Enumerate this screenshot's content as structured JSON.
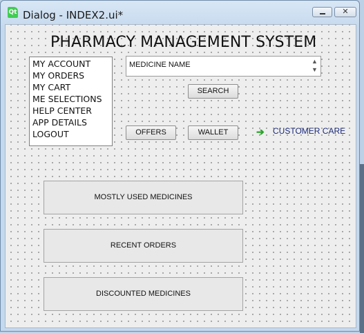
{
  "window": {
    "title": "Dialog - INDEX2.ui*",
    "app_icon_text": "Qt",
    "minimize_label": "",
    "close_label": "✕"
  },
  "main": {
    "heading": "PHARMACY MANAGEMENT SYSTEM",
    "menu_items": [
      "MY ACCOUNT",
      "MY ORDERS",
      "MY CART",
      "ME SELECTIONS",
      "HELP CENTER",
      "APP DETAILS",
      "LOGOUT"
    ],
    "search": {
      "value": "MEDICINE NAME",
      "spin_up": "▲",
      "spin_down": "▼"
    },
    "search_button": "SEARCH",
    "offers_button": "OFFERS",
    "wallet_button": "WALLET",
    "customer_care": {
      "icon": "arrow-right-icon",
      "label": "CUSTOMER CARE",
      "icon_color": "#2aa32a"
    },
    "big_buttons": [
      "MOSTLY USED MEDICINES",
      "RECENT ORDERS",
      "DISCOUNTED MEDICINES"
    ]
  }
}
